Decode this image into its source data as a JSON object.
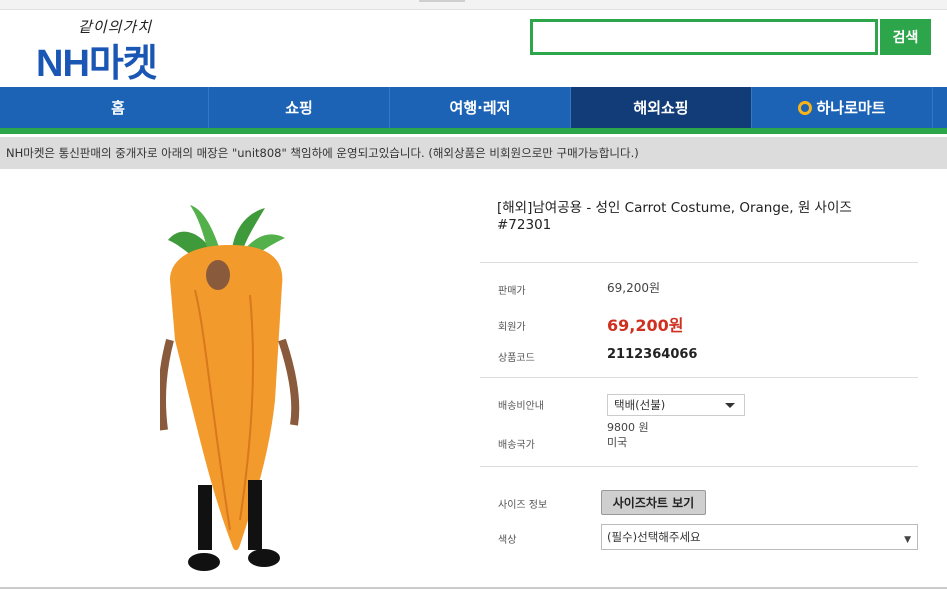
{
  "header": {
    "slogan": "같이의가치",
    "logo_nh": "NH",
    "logo_market": "마켓",
    "search": {
      "value": "",
      "button_label": "검색"
    }
  },
  "nav": {
    "items": [
      {
        "label": "홈"
      },
      {
        "label": "쇼핑"
      },
      {
        "label": "여행·레저"
      },
      {
        "label": "해외쇼핑"
      },
      {
        "label": "하나로마트"
      }
    ],
    "active_index": 3
  },
  "notice": "NH마켓은 통신판매의 중개자로 아래의 매장은 \"unit808\" 책임하에 운영되고있습니다. (해외상품은 비회원으로만 구매가능합니다.)",
  "product": {
    "title": "[해외]남여공용 - 성인 Carrot Costume, Orange, 원 사이즈 #72301",
    "price_label": "판매가",
    "price": "69,200원",
    "member_price_label": "회원가",
    "member_price": "69,200원",
    "code_label": "상품코드",
    "code": "2112364066",
    "shipping_label": "배송비안내",
    "shipping_method": "택배(선불)",
    "shipping_fee": "9800 원",
    "ship_country_label": "배송국가",
    "ship_country": "미국",
    "size_label": "사이즈 정보",
    "size_button": "사이즈차트 보기",
    "color_label": "색상",
    "color_placeholder": "(필수)선택해주세요"
  },
  "colors": {
    "brand_blue": "#1c63b6",
    "brand_green": "#2da54a",
    "active_nav": "#123c78",
    "price_red": "#d0301f"
  }
}
